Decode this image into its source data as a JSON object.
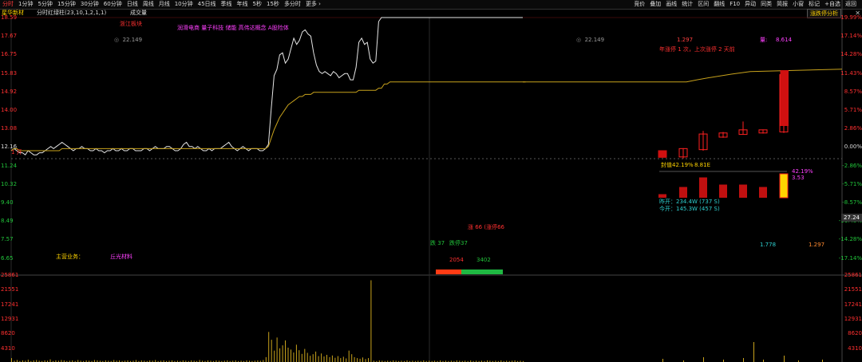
{
  "toolbar": {
    "left": [
      "分时",
      "1分钟",
      "5分钟",
      "15分钟",
      "30分钟",
      "60分钟",
      "日线",
      "周线",
      "月线",
      "10分钟",
      "45日线",
      "季线",
      "年线",
      "5秒",
      "15秒",
      "多分时",
      "更多 ›"
    ],
    "active_index": 0,
    "right": [
      "竞价",
      "叠加",
      "画线",
      "统计",
      "区间",
      "翻线",
      "F10",
      "异动",
      "同类",
      "简报",
      "小窗",
      "标记",
      "+自选",
      "返回"
    ]
  },
  "title": {
    "stock_name": "星华新材",
    "series_text": "分时红绿柱(23,10,1,2,1,1)",
    "volume_label": "成交量",
    "indicator_button": "涨跌停分析",
    "close_icon": "close-icon"
  },
  "left_axis": {
    "price_ticks": [
      "18.59",
      "17.67",
      "16.75",
      "15.83",
      "14.92",
      "14.00",
      "13.08",
      "12.16",
      "11.24",
      "10.32",
      "9.40",
      "8.49",
      "7.57",
      "6.65"
    ],
    "volume_ticks": [
      "25861",
      "21551",
      "17241",
      "12931",
      "8620",
      "4310"
    ]
  },
  "right_axis": {
    "pct_ticks": [
      "19.99%",
      "17.14%",
      "14.28%",
      "11.43%",
      "8.57%",
      "5.71%",
      "2.86%",
      "0.00%",
      "-2.86%",
      "-5.71%",
      "-8.57%",
      "-11.43%",
      "-14.28%",
      "-17.14%"
    ],
    "current_price": "27.24",
    "volume_ticks": [
      "25861",
      "21551",
      "17241",
      "12931",
      "8620",
      "4310"
    ]
  },
  "annotations": {
    "region": "浙江板块",
    "concepts": "润滑电商 量子科技 储能 高伟达概念 A股险体",
    "left_price_ref": "22.149",
    "mid_price_ref": "22.149",
    "mid_ratio": "1.297",
    "purple_label": "量:",
    "purple_value": "8.614",
    "limit_up_note": "年涨停 1 次，上次涨停 2 天前",
    "left_marker": "1 开",
    "seal_ratio": "封值42.19%",
    "seal_amount": "8.81E",
    "bar_pct": "42.19%",
    "bar_val": "3.53",
    "stat1": "昨开：234.4W (737 S)",
    "stat2": "今开：145.3W (457 S)",
    "red_center": "涨 66  (涨停66",
    "green_left": "跌 37",
    "green_right": "跌停37",
    "sell_vol": "2054",
    "buy_vol": "3402",
    "main_business_label": "主营业务：",
    "main_business_value": "丘光材料",
    "cyan_value": "1.778",
    "orange_value": "1.297"
  },
  "chart_data": {
    "type": "line",
    "title": "",
    "xlabel": "",
    "ylabel": "",
    "ylim": [
      6.65,
      18.59
    ],
    "prev_close": 12.16,
    "limit_up": 14.59,
    "series": [
      {
        "values": [
          12.2,
          12.3,
          12.2,
          12.1,
          12.1,
          12.0,
          12.2,
          12.1,
          12.0,
          12.0,
          12.1,
          12.1,
          12.2,
          12.3,
          12.4,
          12.3,
          12.4,
          12.5,
          12.6,
          12.5,
          12.4,
          12.3,
          12.2,
          12.3,
          12.3,
          12.4,
          12.3,
          12.3,
          12.2,
          12.2,
          12.3,
          12.2,
          12.2,
          12.1,
          12.2,
          12.2,
          12.3,
          12.2,
          12.2,
          12.3,
          12.2,
          12.2,
          12.3,
          12.3,
          12.2,
          12.2,
          12.2,
          12.3,
          12.3,
          12.2,
          12.3,
          12.4,
          12.3,
          12.3,
          12.3,
          12.4,
          12.4,
          12.3,
          12.2,
          12.2,
          12.3,
          12.5,
          12.6,
          12.4,
          12.4,
          12.3,
          12.4,
          12.3,
          12.2,
          12.2,
          12.3,
          12.2,
          12.3,
          12.3,
          12.3,
          12.4,
          12.5,
          12.6,
          12.4,
          12.3,
          12.2,
          12.3,
          12.4,
          12.3,
          12.2,
          12.3,
          12.3,
          12.3,
          12.2,
          12.2,
          12.3,
          12.5,
          14.2,
          15.8,
          16.1,
          16.8,
          16.9,
          16.4,
          16.6,
          17.1,
          17.6,
          17.3,
          17.5,
          17.9,
          18.0,
          17.8,
          17.7,
          16.9,
          16.3,
          16.0,
          15.9,
          16.0,
          15.9,
          15.8,
          16.0,
          15.9,
          15.7,
          15.8,
          15.9,
          15.9,
          15.6,
          15.6,
          16.2,
          17.4,
          17.6,
          17.3,
          17.4,
          16.6,
          16.4,
          16.5,
          18.4,
          18.59,
          18.59,
          18.59,
          18.59,
          18.59,
          18.59,
          18.59,
          18.59,
          18.59,
          18.59,
          18.59,
          18.59,
          18.59,
          18.59,
          18.59,
          18.59,
          18.59,
          18.59,
          18.59,
          18.59,
          18.59,
          18.59,
          18.59,
          18.59,
          18.59,
          18.59,
          18.59,
          18.59,
          18.59,
          18.59,
          18.59,
          18.59,
          18.59,
          18.59,
          18.59,
          18.59,
          18.59,
          18.59,
          18.59,
          18.59,
          18.59,
          18.59,
          18.59,
          18.59,
          18.59,
          18.59,
          18.59,
          18.59,
          18.59,
          18.59,
          18.59
        ]
      },
      {
        "values": [
          12.2,
          12.3,
          12.3,
          12.2,
          12.2,
          12.2,
          12.2,
          12.2,
          12.2,
          12.2,
          12.2,
          12.2,
          12.2,
          12.2,
          12.2,
          12.2,
          12.2,
          12.2,
          12.3,
          12.3,
          12.3,
          12.3,
          12.3,
          12.3,
          12.3,
          12.3,
          12.3,
          12.3,
          12.3,
          12.3,
          12.3,
          12.3,
          12.3,
          12.3,
          12.3,
          12.3,
          12.3,
          12.3,
          12.3,
          12.3,
          12.3,
          12.3,
          12.3,
          12.3,
          12.3,
          12.3,
          12.3,
          12.3,
          12.3,
          12.3,
          12.3,
          12.3,
          12.3,
          12.3,
          12.3,
          12.3,
          12.3,
          12.3,
          12.3,
          12.3,
          12.3,
          12.3,
          12.3,
          12.3,
          12.3,
          12.3,
          12.3,
          12.3,
          12.3,
          12.3,
          12.3,
          12.3,
          12.3,
          12.3,
          12.3,
          12.3,
          12.3,
          12.3,
          12.3,
          12.3,
          12.3,
          12.3,
          12.3,
          12.3,
          12.3,
          12.3,
          12.3,
          12.3,
          12.3,
          12.3,
          12.3,
          12.4,
          12.8,
          13.2,
          13.5,
          13.8,
          14.0,
          14.2,
          14.4,
          14.5,
          14.6,
          14.7,
          14.8,
          14.8,
          14.9,
          14.9,
          14.9,
          15.0,
          15.0,
          15.0,
          15.0,
          15.0,
          15.0,
          15.0,
          15.0,
          15.0,
          15.0,
          15.0,
          15.0,
          15.0,
          15.0,
          15.0,
          15.0,
          15.1,
          15.1,
          15.1,
          15.1,
          15.1,
          15.1,
          15.1,
          15.2,
          15.2,
          15.4,
          15.4,
          15.5,
          15.5,
          15.5,
          15.5,
          15.5,
          15.5,
          15.5,
          15.5,
          15.5,
          15.5,
          15.5,
          15.5,
          15.5,
          15.5,
          15.5,
          15.5,
          15.5,
          15.5,
          15.5,
          15.5,
          15.5,
          15.5,
          15.5,
          15.5,
          15.5,
          15.5,
          15.5,
          15.5,
          15.5,
          15.5,
          15.5,
          15.5,
          15.5,
          15.5,
          15.5,
          15.5,
          15.5,
          15.5,
          15.5,
          15.5,
          15.5,
          15.5,
          15.5,
          15.5,
          15.5,
          15.5,
          15.5,
          15.5,
          15.5
        ]
      }
    ],
    "volume": [
      1.2,
      0.4,
      0.6,
      0.3,
      0.5,
      0.4,
      0.7,
      0.3,
      0.5,
      0.6,
      0.4,
      0.3,
      0.5,
      0.4,
      0.8,
      0.3,
      0.5,
      0.4,
      0.6,
      0.5,
      0.3,
      0.4,
      0.5,
      0.3,
      0.6,
      0.4,
      0.3,
      0.5,
      0.4,
      0.3,
      0.6,
      0.5,
      0.4,
      0.3,
      0.5,
      0.4,
      0.3,
      0.6,
      0.4,
      0.5,
      0.3,
      0.4,
      0.5,
      0.3,
      0.4,
      0.6,
      0.3,
      0.5,
      0.4,
      0.3,
      0.5,
      0.4,
      0.6,
      0.3,
      0.4,
      0.5,
      0.3,
      0.4,
      0.5,
      0.3,
      0.4,
      0.3,
      0.5,
      0.4,
      0.3,
      0.5,
      0.4,
      0.3,
      0.6,
      0.4,
      0.3,
      0.5,
      0.4,
      0.3,
      0.5,
      0.4,
      0.3,
      0.4,
      0.5,
      0.3,
      0.4,
      0.5,
      0.3,
      0.4,
      0.3,
      0.5,
      0.4,
      0.3,
      0.4,
      0.5,
      0.4,
      0.6,
      1.5,
      9.2,
      6.8,
      3.5,
      7.5,
      4.2,
      5.1,
      6.6,
      4.4,
      3.8,
      2.9,
      5.3,
      3.6,
      2.5,
      4.0,
      2.8,
      1.9,
      2.4,
      3.2,
      1.8,
      2.6,
      1.7,
      2.2,
      1.5,
      2.0,
      1.3,
      1.8,
      1.2,
      1.6,
      1.1,
      3.5,
      2.4,
      1.5,
      1.2,
      1.0,
      1.4,
      0.9,
      1.2,
      25.0,
      0.4,
      0.3,
      0.5,
      0.4,
      0.3,
      0.4,
      0.3,
      0.5,
      0.4,
      0.3,
      0.4,
      0.3,
      0.5,
      0.3,
      0.4,
      0.3,
      0.4,
      0.3,
      0.5,
      0.3,
      0.4,
      0.3,
      0.4,
      0.3,
      0.5,
      0.3,
      0.4,
      0.3,
      0.4,
      0.3,
      0.5,
      0.4,
      0.3,
      0.4,
      0.3,
      0.5,
      0.3,
      0.4,
      0.3,
      0.4,
      0.3,
      0.5,
      0.4,
      0.3,
      0.4,
      0.3,
      0.5,
      0.3,
      0.4,
      0.3,
      0.4,
      0.5,
      0.3,
      0.4,
      0.3
    ]
  },
  "candles": [
    {
      "o": 12.2,
      "c": 11.88,
      "h": 12.2,
      "l": 11.86
    },
    {
      "o": 11.9,
      "c": 12.3,
      "h": 12.32,
      "l": 11.82
    },
    {
      "o": 12.25,
      "c": 13.0,
      "h": 13.15,
      "l": 12.2
    },
    {
      "o": 12.85,
      "c": 13.05,
      "h": 13.1,
      "l": 12.82
    },
    {
      "o": 12.98,
      "c": 13.2,
      "h": 13.6,
      "l": 12.98
    },
    {
      "o": 13.05,
      "c": 13.2,
      "h": 13.22,
      "l": 13.02
    },
    {
      "o": 13.1,
      "c": 15.85,
      "h": 15.88,
      "l": 13.05
    }
  ],
  "seal_bars": [
    0.15,
    0.45,
    0.85,
    0.55,
    0.55,
    0.45,
    1.0
  ]
}
